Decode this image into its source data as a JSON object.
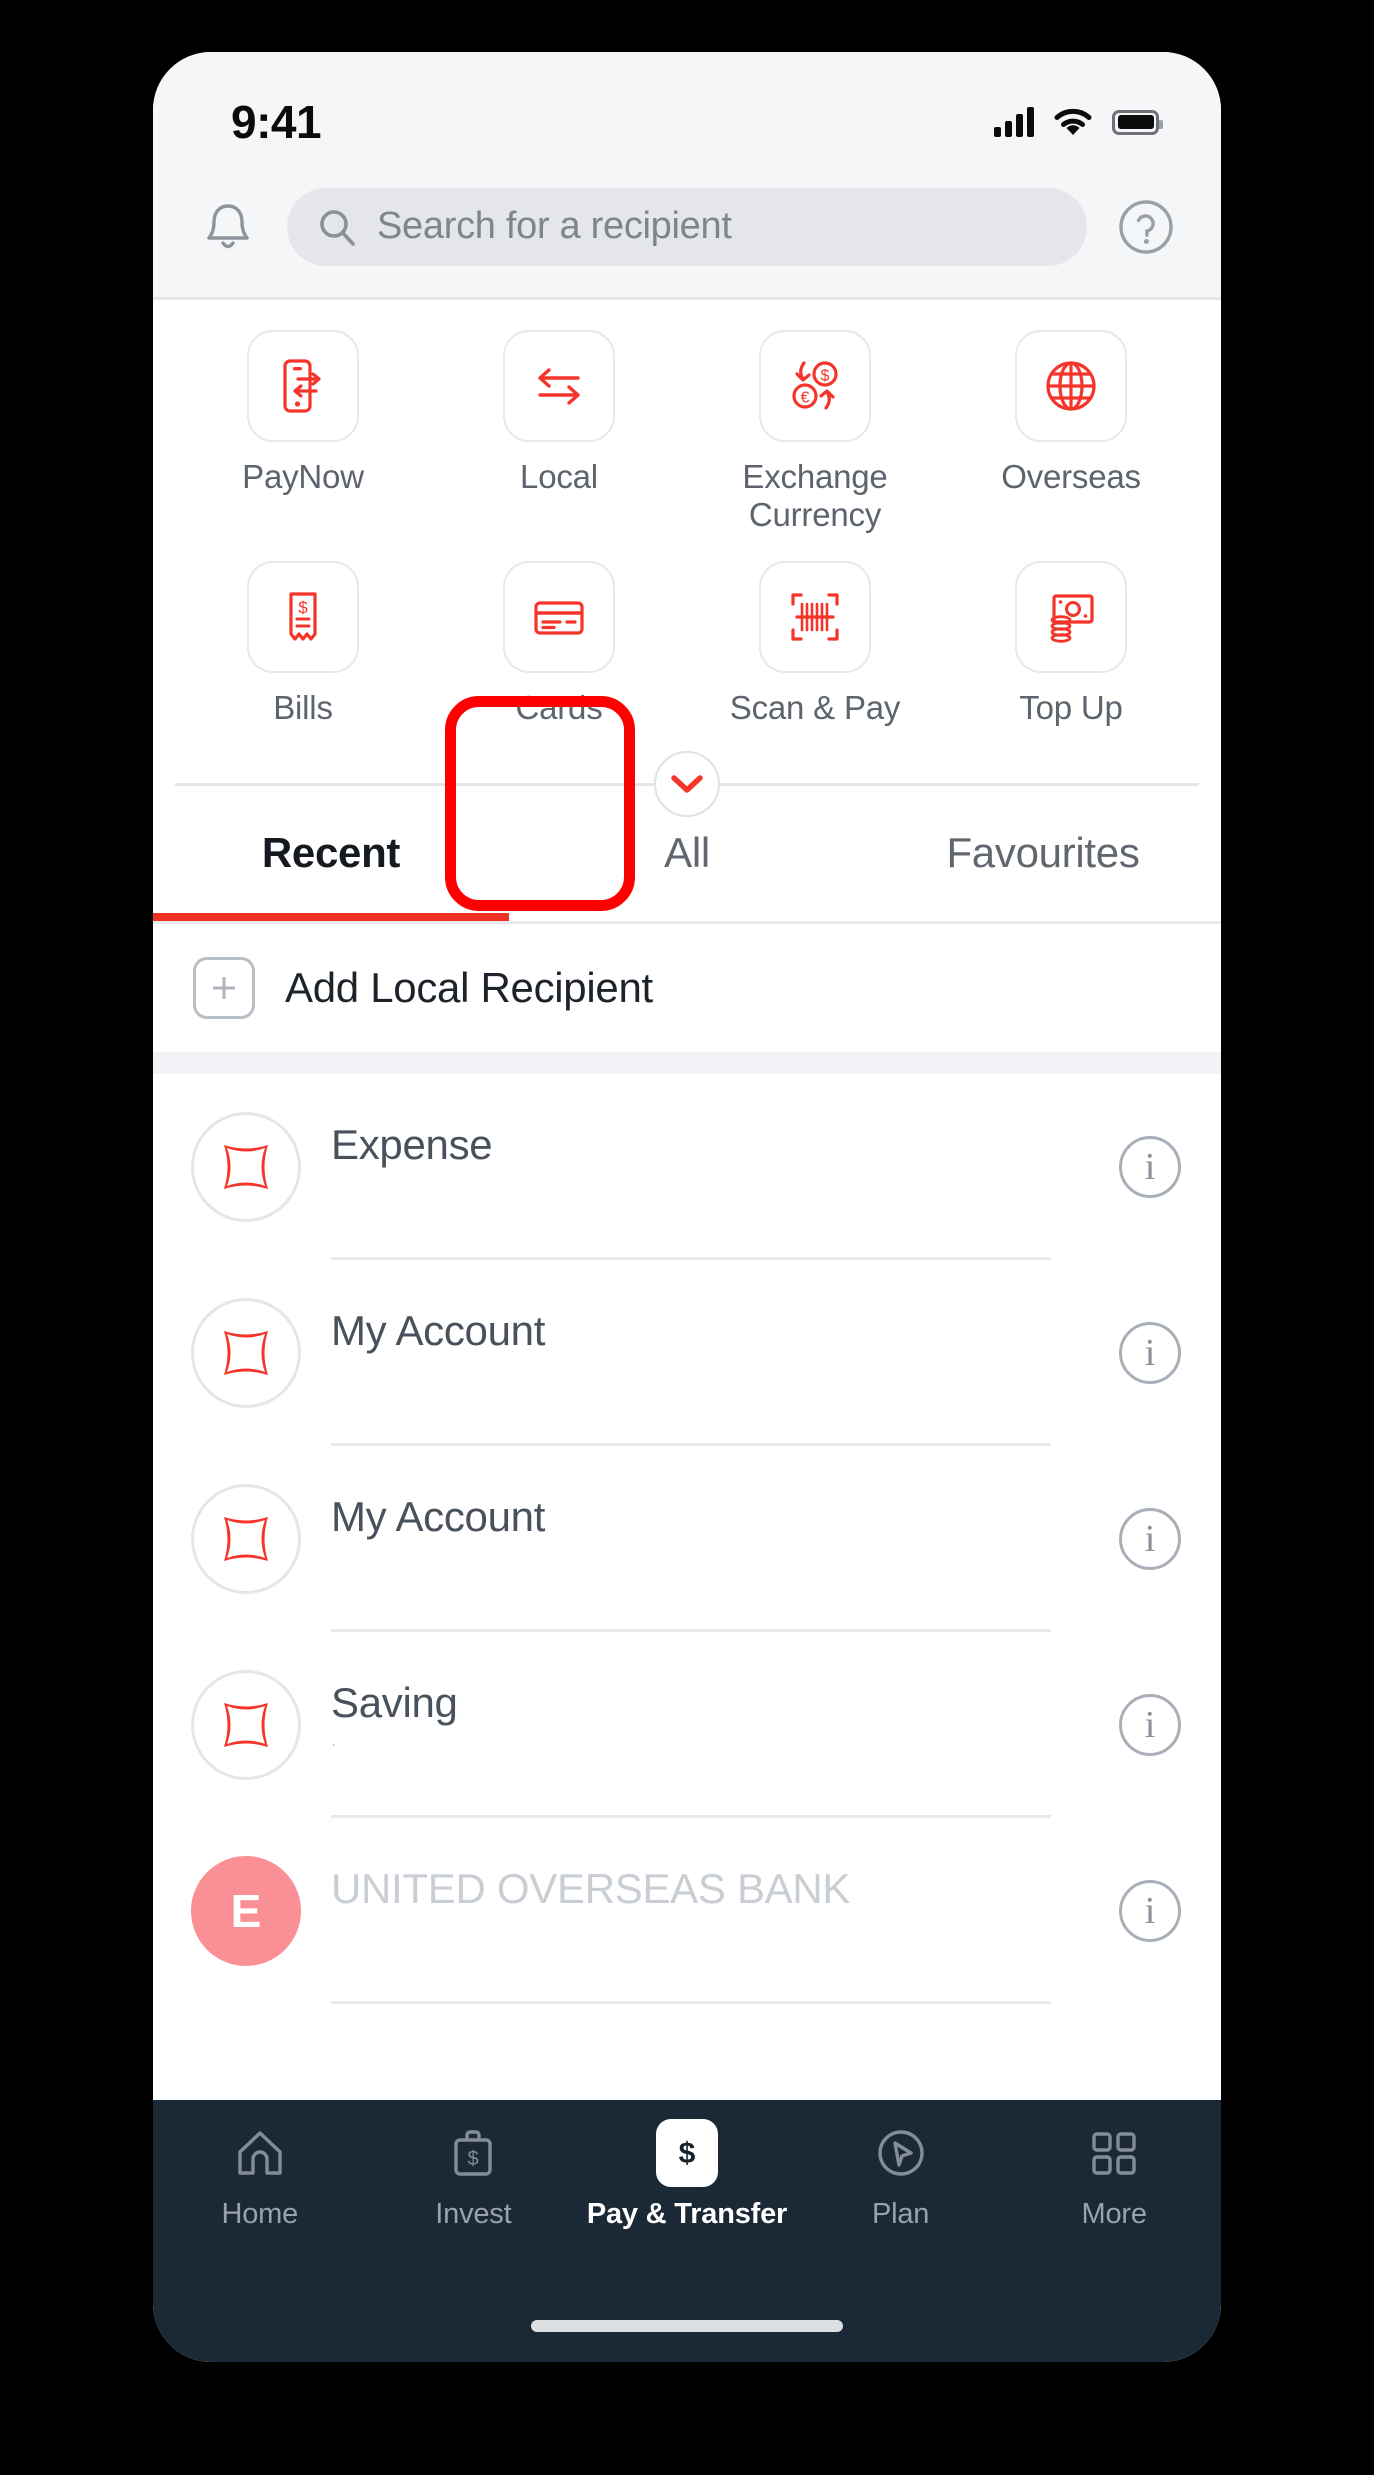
{
  "status_bar": {
    "time": "9:41",
    "signal_icon": "signal-bars-icon",
    "wifi_icon": "wifi-icon",
    "battery_icon": "battery-full-icon"
  },
  "header": {
    "notifications_icon": "bell-icon",
    "help_icon": "help-circle-icon",
    "search_placeholder": "Search for a recipient",
    "search_icon": "search-icon",
    "search_value": ""
  },
  "quick_actions": {
    "expand_icon": "chevron-down-icon",
    "highlighted": "Cards",
    "items": [
      {
        "label": "PayNow",
        "icon": "phone-transfer-icon"
      },
      {
        "label": "Local",
        "icon": "two-arrows-icon"
      },
      {
        "label": "Exchange Currency",
        "icon": "currency-exchange-icon"
      },
      {
        "label": "Overseas",
        "icon": "globe-icon"
      },
      {
        "label": "Bills",
        "icon": "bill-receipt-icon"
      },
      {
        "label": "Cards",
        "icon": "credit-card-icon"
      },
      {
        "label": "Scan & Pay",
        "icon": "barcode-scan-icon"
      },
      {
        "label": "Top Up",
        "icon": "cash-stack-icon"
      }
    ]
  },
  "tabs": {
    "active": "Recent",
    "items": [
      {
        "label": "Recent"
      },
      {
        "label": "All"
      },
      {
        "label": "Favourites"
      }
    ]
  },
  "add_recipient": {
    "label": "Add Local Recipient",
    "icon": "plus-icon"
  },
  "recipients": {
    "info_icon": "info-circle-icon",
    "items": [
      {
        "name": "Expense",
        "sub": "",
        "avatar": "uob-logo-icon",
        "avatar_type": "logo"
      },
      {
        "name": "My Account",
        "sub": "",
        "avatar": "uob-logo-icon",
        "avatar_type": "logo"
      },
      {
        "name": "My Account",
        "sub": "",
        "avatar": "uob-logo-icon",
        "avatar_type": "logo"
      },
      {
        "name": "Saving",
        "sub": ".",
        "avatar": "uob-logo-icon",
        "avatar_type": "logo"
      },
      {
        "name": "UNITED OVERSEAS BANK",
        "sub": "",
        "avatar": "E",
        "avatar_type": "initial"
      }
    ]
  },
  "bottom_nav": {
    "active": "Pay & Transfer",
    "items": [
      {
        "label": "Home",
        "icon": "home-icon"
      },
      {
        "label": "Invest",
        "icon": "briefcase-dollar-icon"
      },
      {
        "label": "Pay & Transfer",
        "icon": "dollar-chip-icon"
      },
      {
        "label": "Plan",
        "icon": "compass-arrow-icon"
      },
      {
        "label": "More",
        "icon": "grid-2x2-icon"
      }
    ]
  },
  "colors": {
    "brand_red": "#ee3124",
    "highlight_red": "#ff0000",
    "nav_dark": "#1b2936",
    "avatar_pink": "#fa9096"
  }
}
